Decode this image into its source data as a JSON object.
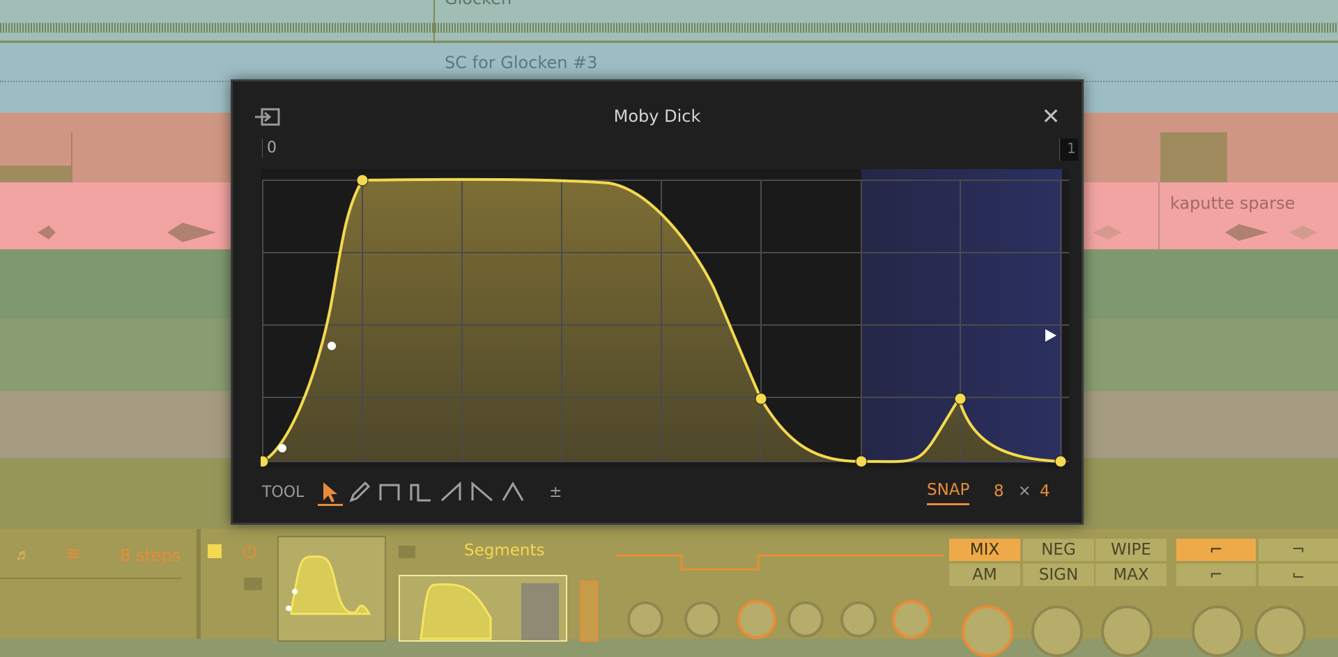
{
  "tracks": [
    {
      "label": "Glocken"
    },
    {
      "label": "SC for Glocken #3"
    },
    {
      "label": ""
    },
    {
      "label": "kaputte sparse"
    }
  ],
  "modal": {
    "title": "Moby Dick",
    "ruler_start": "0",
    "ruler_end": "1",
    "close_icon": "close-icon",
    "import_icon": "import-icon"
  },
  "toolbar": {
    "tool_label": "TOOL",
    "tools": [
      "arrow-tool",
      "pencil-tool",
      "square-wave-tool",
      "pulse-wave-tool",
      "ramp-up-tool",
      "ramp-down-tool",
      "triangle-tool"
    ],
    "plus_minus": "±",
    "snap_label": "SNAP",
    "snap_x": "8",
    "snap_times": "×",
    "snap_y": "4"
  },
  "device": {
    "steps_label": "8 steps",
    "segments_label": "Segments",
    "mix_buttons": [
      "MIX",
      "NEG",
      "WIPE",
      "AM",
      "SIGN",
      "MAX"
    ],
    "active_mix": "MIX"
  },
  "colors": {
    "curve": "#f3d94f",
    "selection": "#2a2e57",
    "accent": "#e98c3a",
    "panel": "#1f1f1f"
  }
}
